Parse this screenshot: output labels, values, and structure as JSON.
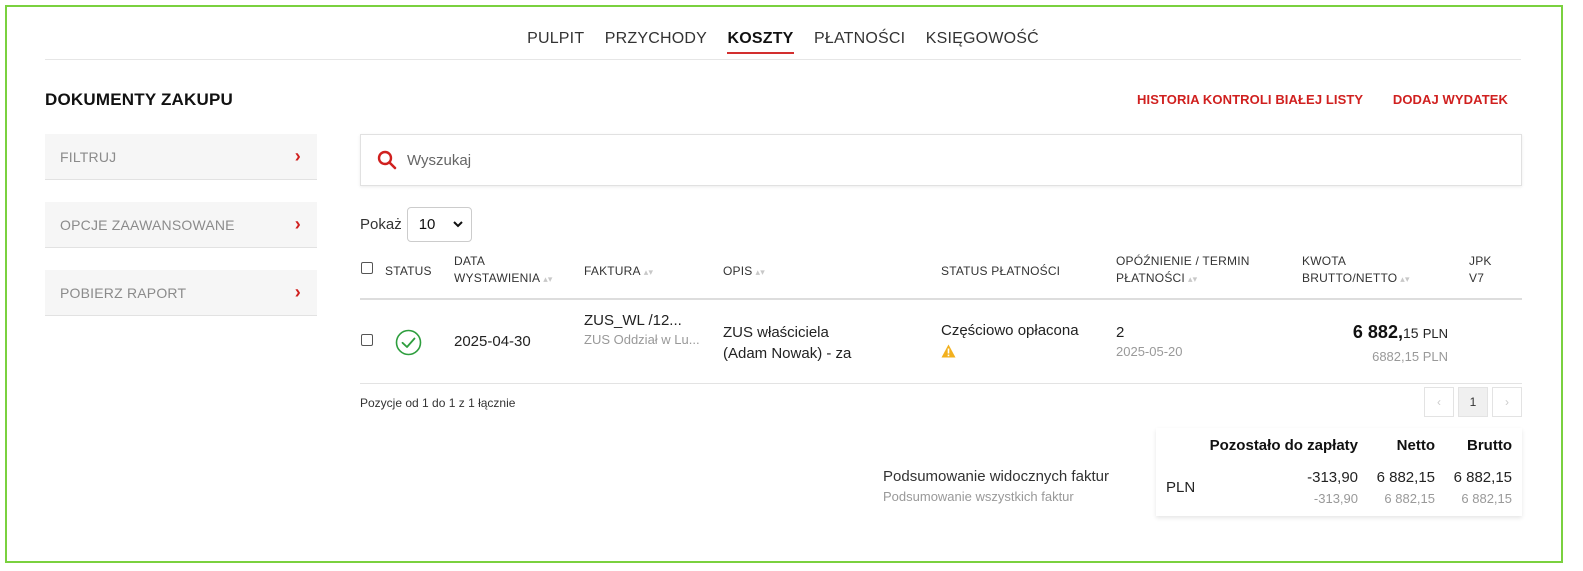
{
  "nav": {
    "tabs": [
      {
        "label": "PULPIT"
      },
      {
        "label": "PRZYCHODY"
      },
      {
        "label": "KOSZTY"
      },
      {
        "label": "PŁATNOŚCI"
      },
      {
        "label": "KSIĘGOWOŚĆ"
      }
    ],
    "active_index": 2
  },
  "page_title": "DOKUMENTY ZAKUPU",
  "actions": {
    "history_label": "HISTORIA KONTROLI BIAŁEJ LISTY",
    "add_expense_label": "DODAJ WYDATEK"
  },
  "sidebar": {
    "items": [
      {
        "label": "FILTRUJ"
      },
      {
        "label": "OPCJE ZAAWANSOWANE"
      },
      {
        "label": "POBIERZ RAPORT"
      }
    ]
  },
  "search": {
    "placeholder": "Wyszukaj"
  },
  "show": {
    "label": "Pokaż",
    "value": "10"
  },
  "table": {
    "headers": {
      "status": "STATUS",
      "date_line1": "DATA",
      "date_line2": "WYSTAWIENIA",
      "invoice": "FAKTURA",
      "desc": "OPIS",
      "payment_status": "STATUS PŁATNOŚCI",
      "delay_line1": "OPÓŹNIENIE / TERMIN",
      "delay_line2": "PŁATNOŚCI",
      "amount_line1": "KWOTA",
      "amount_line2": "BRUTTO/NETTO",
      "jpk_line1": "JPK",
      "jpk_line2": "V7"
    },
    "rows": [
      {
        "date": "2025-04-30",
        "invoice": "ZUS_WL /12...",
        "invoice_sub": "ZUS Oddział w Lu...",
        "desc_line1": "ZUS właściciela",
        "desc_line2": "(Adam Nowak) - za",
        "payment_status": "Częściowo opłacona",
        "delay": "2",
        "due_date": "2025-05-20",
        "gross_main": "6 882,",
        "gross_cents": "15",
        "currency": "PLN",
        "net": "6882,15 PLN"
      }
    ]
  },
  "pagination": {
    "info": "Pozycje od 1 do 1 z 1 łącznie",
    "prev": "‹",
    "page": "1",
    "next": "›"
  },
  "summary": {
    "visible_label": "Podsumowanie widocznych faktur",
    "all_label": "Podsumowanie wszystkich faktur",
    "col_remaining": "Pozostało do zapłaty",
    "col_net": "Netto",
    "col_gross": "Brutto",
    "currency": "PLN",
    "visible": {
      "remaining": "-313,90",
      "net": "6 882,15",
      "gross": "6 882,15"
    },
    "all": {
      "remaining": "-313,90",
      "net": "6 882,15",
      "gross": "6 882,15"
    }
  },
  "colors": {
    "accent": "#d0201f",
    "ok": "#2e9e3e",
    "warn": "#f2b01e",
    "frame": "#7ad13f"
  }
}
